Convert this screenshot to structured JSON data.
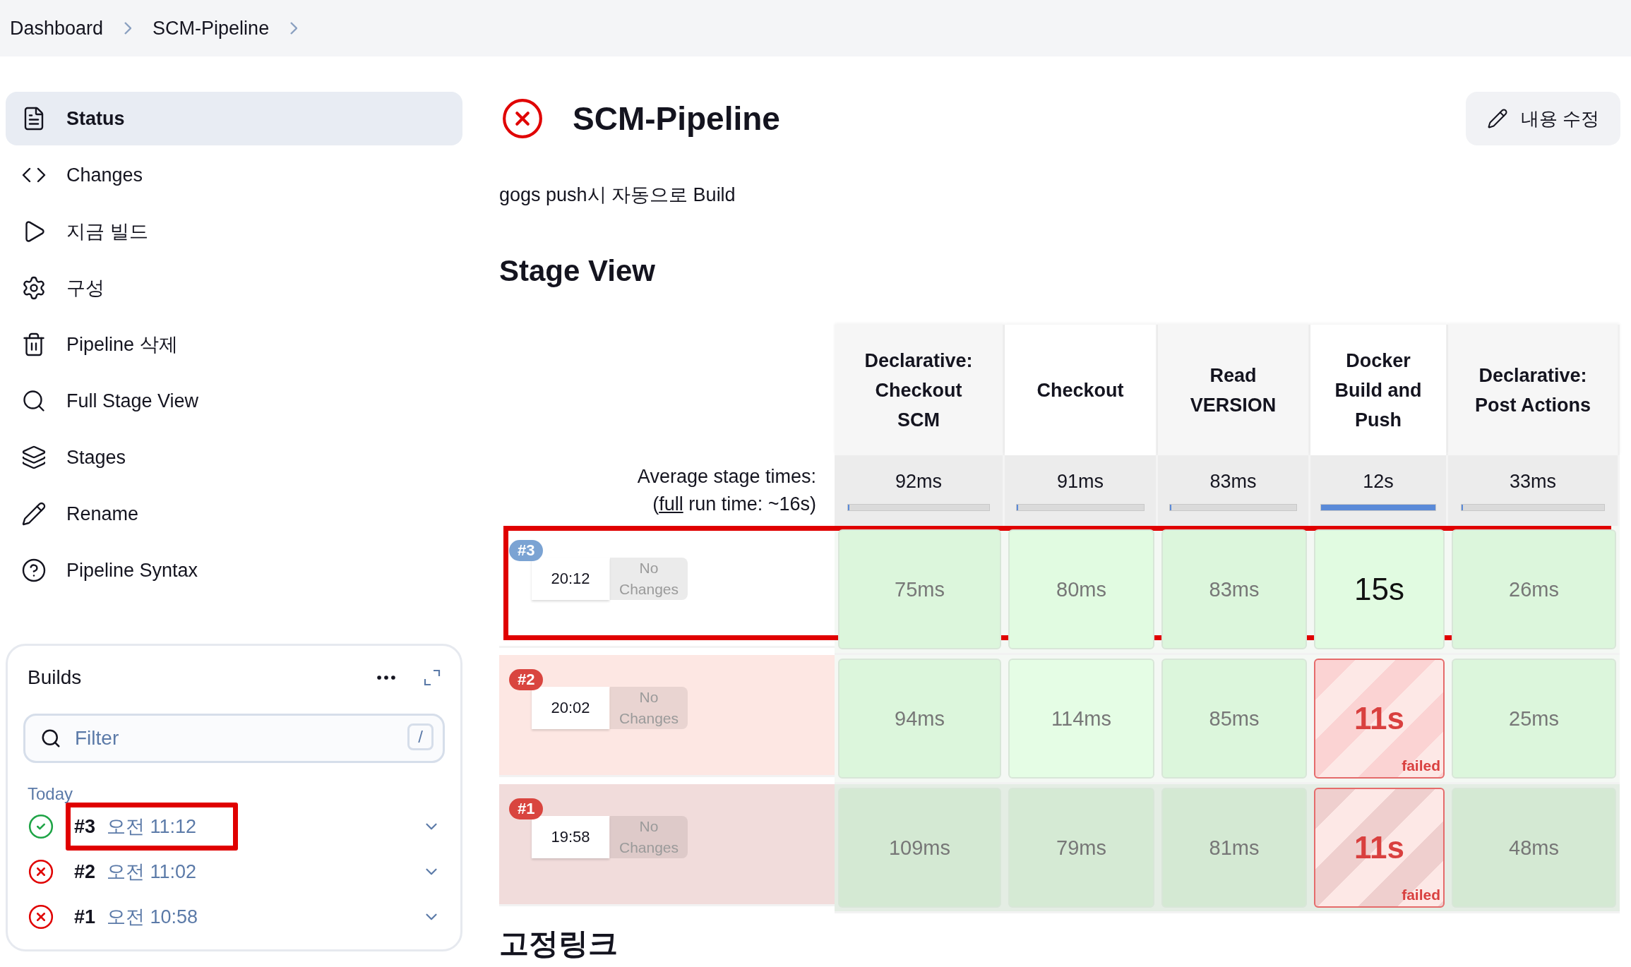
{
  "breadcrumbs": [
    "Dashboard",
    "SCM-Pipeline"
  ],
  "sidebar": {
    "items": [
      {
        "label": "Status",
        "selected": true
      },
      {
        "label": "Changes",
        "selected": false
      },
      {
        "label": "지금 빌드",
        "selected": false
      },
      {
        "label": "구성",
        "selected": false
      },
      {
        "label": "Pipeline 삭제",
        "selected": false
      },
      {
        "label": "Full Stage View",
        "selected": false
      },
      {
        "label": "Stages",
        "selected": false
      },
      {
        "label": "Rename",
        "selected": false
      },
      {
        "label": "Pipeline Syntax",
        "selected": false
      }
    ]
  },
  "builds": {
    "title": "Builds",
    "filter": {
      "placeholder": "Filter",
      "shortcut": "/"
    },
    "group": "Today",
    "items": [
      {
        "number": "#3",
        "time": "오전 11:12",
        "kind": "success",
        "highlighted": true
      },
      {
        "number": "#2",
        "time": "오전 11:02",
        "kind": "failed",
        "highlighted": false
      },
      {
        "number": "#1",
        "time": "오전 10:58",
        "kind": "failed",
        "highlighted": false
      }
    ]
  },
  "header": {
    "title": "SCM-Pipeline",
    "kind": "failed",
    "edit_button": "내용 수정",
    "description": "gogs push시 자동으로 Build"
  },
  "stage_view": {
    "title": "Stage View",
    "average_label": "Average stage times:",
    "full_run_prefix": "(",
    "full_run_link": "full",
    "full_run_suffix": " run time: ~16s)",
    "stages": [
      {
        "name": "Declarative: Checkout SCM",
        "average": "92ms",
        "level": 0.01
      },
      {
        "name": "Checkout",
        "average": "91ms",
        "level": 0.01
      },
      {
        "name": "Read VERSION",
        "average": "83ms",
        "level": 0.01
      },
      {
        "name": "Docker Build and Push",
        "average": "12s",
        "level": 1
      },
      {
        "name": "Declarative: Post Actions",
        "average": "33ms",
        "level": 0.01
      }
    ],
    "runs": [
      {
        "badge": "#3",
        "kind": "success",
        "time": "20:12",
        "changes": "No Changes",
        "highlighted": true,
        "cells": [
          {
            "duration": "75ms",
            "kind": "success",
            "focused": false
          },
          {
            "duration": "80ms",
            "kind": "success",
            "focused": false
          },
          {
            "duration": "83ms",
            "kind": "success",
            "focused": false
          },
          {
            "duration": "15s",
            "kind": "success",
            "focused": true
          },
          {
            "duration": "26ms",
            "kind": "success",
            "focused": false
          }
        ]
      },
      {
        "badge": "#2",
        "kind": "failed",
        "time": "20:02",
        "changes": "No Changes",
        "highlighted": false,
        "cells": [
          {
            "duration": "94ms",
            "kind": "success",
            "focused": false
          },
          {
            "duration": "114ms",
            "kind": "success",
            "focused": false
          },
          {
            "duration": "85ms",
            "kind": "success",
            "focused": false
          },
          {
            "duration": "11s",
            "kind": "failed",
            "note": "failed",
            "focused": false
          },
          {
            "duration": "25ms",
            "kind": "success",
            "focused": false
          }
        ]
      },
      {
        "badge": "#1",
        "kind": "failed",
        "time": "19:58",
        "changes": "No Changes",
        "highlighted": false,
        "cells": [
          {
            "duration": "109ms",
            "kind": "success",
            "focused": false
          },
          {
            "duration": "79ms",
            "kind": "success",
            "focused": false
          },
          {
            "duration": "81ms",
            "kind": "success",
            "focused": false
          },
          {
            "duration": "11s",
            "kind": "failed",
            "note": "failed",
            "focused": false
          },
          {
            "duration": "48ms",
            "kind": "success",
            "focused": false
          }
        ]
      }
    ]
  },
  "permalinks": {
    "title": "고정링크"
  }
}
